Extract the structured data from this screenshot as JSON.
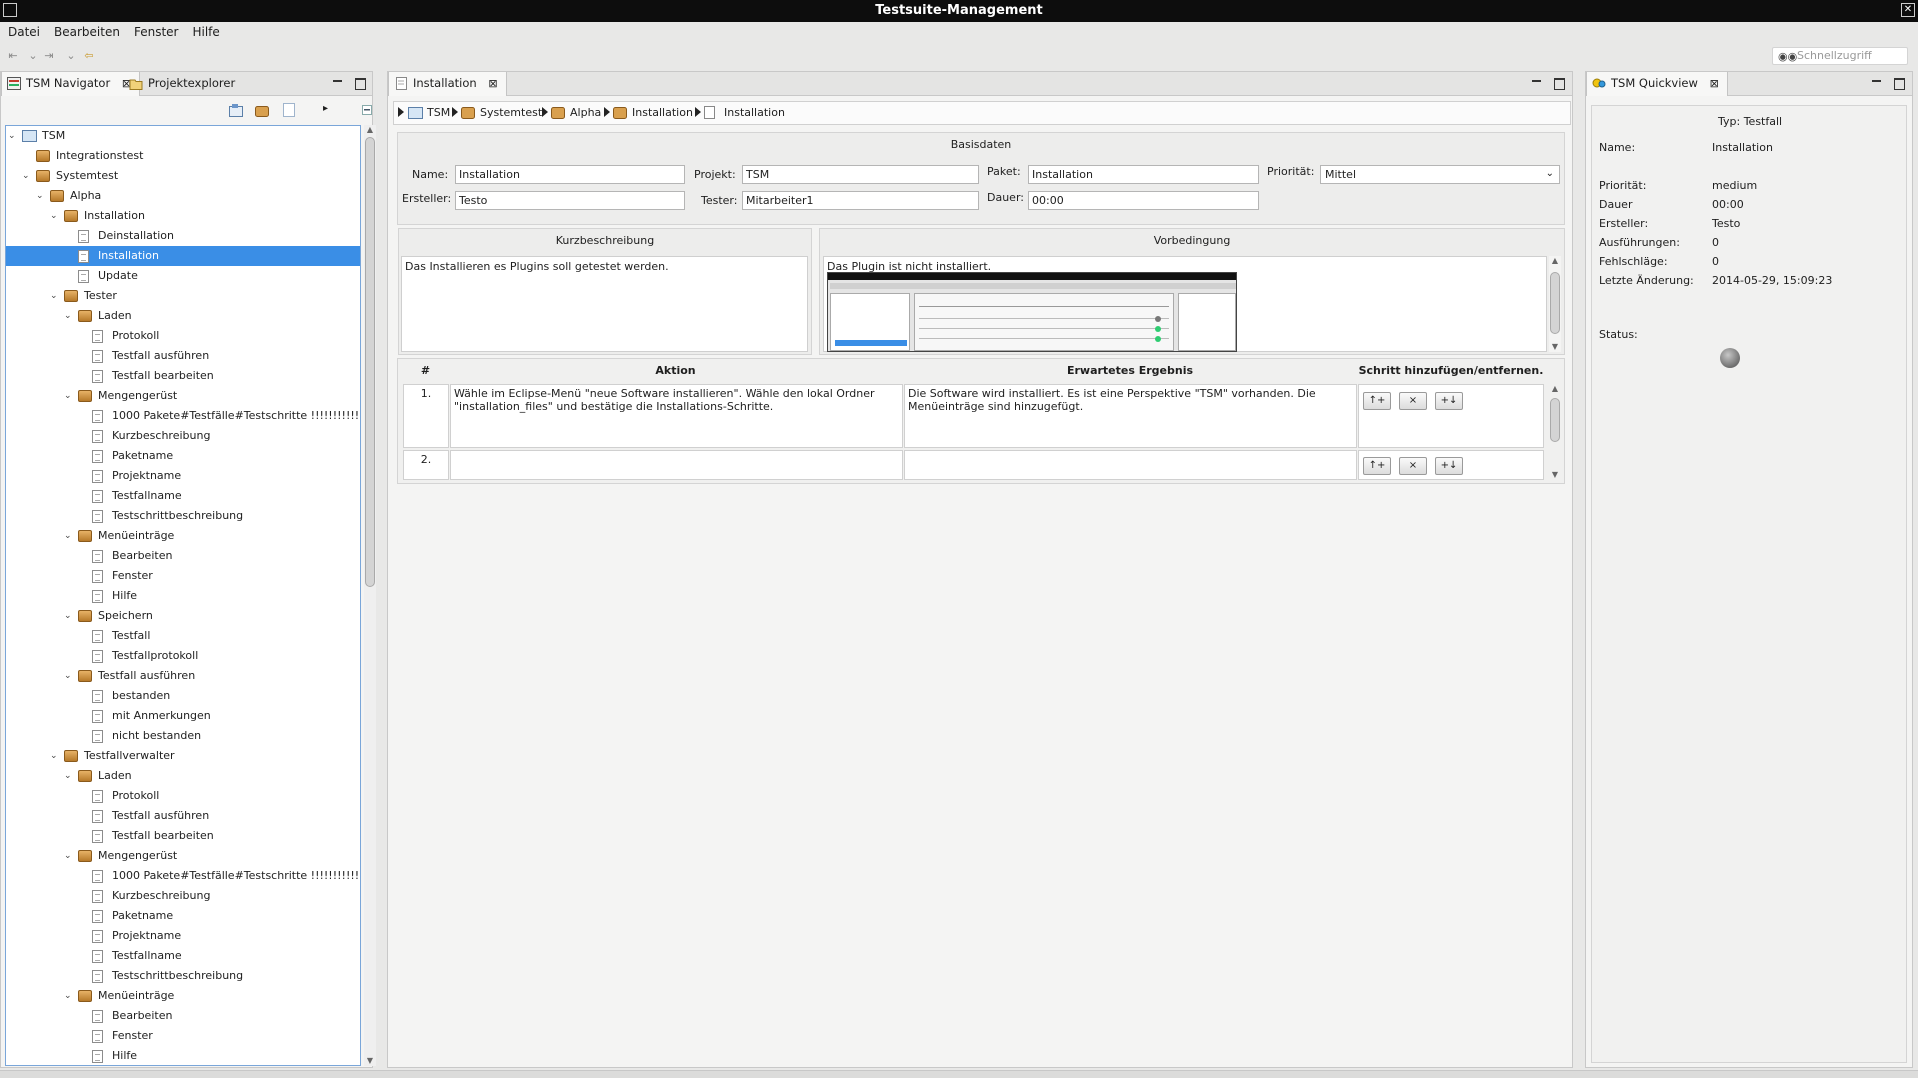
{
  "window": {
    "title": "Testsuite-Management"
  },
  "menu": {
    "items": [
      {
        "label": "Datei"
      },
      {
        "label": "Bearbeiten"
      },
      {
        "label": "Fenster"
      },
      {
        "label": "Hilfe"
      }
    ]
  },
  "toolbar": {
    "quick_access_placeholder": "Schnellzugriff"
  },
  "left_view": {
    "tabs": [
      {
        "label": "TSM Navigator",
        "active": true
      },
      {
        "label": "Projektexplorer",
        "active": false
      }
    ],
    "tree": [
      {
        "label": "TSM",
        "type": "root",
        "depth": 0,
        "expanded": true
      },
      {
        "label": "Integrationstest",
        "type": "pkg",
        "depth": 1
      },
      {
        "label": "Systemtest",
        "type": "pkg",
        "depth": 1,
        "expanded": true
      },
      {
        "label": "Alpha",
        "type": "pkg",
        "depth": 2,
        "expanded": true
      },
      {
        "label": "Installation",
        "type": "pkg",
        "depth": 3,
        "expanded": true
      },
      {
        "label": "Deinstallation",
        "type": "doc",
        "depth": 4
      },
      {
        "label": "Installation",
        "type": "doc",
        "depth": 4,
        "selected": true
      },
      {
        "label": "Update",
        "type": "doc",
        "depth": 4
      },
      {
        "label": "Tester",
        "type": "pkg",
        "depth": 3,
        "expanded": true
      },
      {
        "label": "Laden",
        "type": "pkg",
        "depth": 4,
        "expanded": true
      },
      {
        "label": "Protokoll",
        "type": "doc",
        "depth": 5
      },
      {
        "label": "Testfall ausführen",
        "type": "doc",
        "depth": 5
      },
      {
        "label": "Testfall bearbeiten",
        "type": "doc",
        "depth": 5
      },
      {
        "label": "Mengengerüst",
        "type": "pkg",
        "depth": 4,
        "expanded": true
      },
      {
        "label": "1000 Pakete#Testfälle#Testschritte !!!!!!!!!!!",
        "type": "doc",
        "depth": 5
      },
      {
        "label": "Kurzbeschreibung",
        "type": "doc",
        "depth": 5
      },
      {
        "label": "Paketname",
        "type": "doc",
        "depth": 5
      },
      {
        "label": "Projektname",
        "type": "doc",
        "depth": 5
      },
      {
        "label": "Testfallname",
        "type": "doc",
        "depth": 5
      },
      {
        "label": "Testschrittbeschreibung",
        "type": "doc",
        "depth": 5
      },
      {
        "label": "Menüeinträge",
        "type": "pkg",
        "depth": 4,
        "expanded": true
      },
      {
        "label": "Bearbeiten",
        "type": "doc",
        "depth": 5
      },
      {
        "label": "Fenster",
        "type": "doc",
        "depth": 5
      },
      {
        "label": "Hilfe",
        "type": "doc",
        "depth": 5
      },
      {
        "label": "Speichern",
        "type": "pkg",
        "depth": 4,
        "expanded": true
      },
      {
        "label": "Testfall",
        "type": "doc",
        "depth": 5
      },
      {
        "label": "Testfallprotokoll",
        "type": "doc",
        "depth": 5
      },
      {
        "label": "Testfall ausführen",
        "type": "pkg",
        "depth": 4,
        "expanded": true
      },
      {
        "label": "bestanden",
        "type": "doc",
        "depth": 5
      },
      {
        "label": "mit Anmerkungen",
        "type": "doc",
        "depth": 5
      },
      {
        "label": "nicht bestanden",
        "type": "doc",
        "depth": 5
      },
      {
        "label": "Testfallverwalter",
        "type": "pkg",
        "depth": 3,
        "expanded": true
      },
      {
        "label": "Laden",
        "type": "pkg",
        "depth": 4,
        "expanded": true
      },
      {
        "label": "Protokoll",
        "type": "doc",
        "depth": 5
      },
      {
        "label": "Testfall ausführen",
        "type": "doc",
        "depth": 5
      },
      {
        "label": "Testfall bearbeiten",
        "type": "doc",
        "depth": 5
      },
      {
        "label": "Mengengerüst",
        "type": "pkg",
        "depth": 4,
        "expanded": true
      },
      {
        "label": "1000 Pakete#Testfälle#Testschritte !!!!!!!!!!!",
        "type": "doc",
        "depth": 5
      },
      {
        "label": "Kurzbeschreibung",
        "type": "doc",
        "depth": 5
      },
      {
        "label": "Paketname",
        "type": "doc",
        "depth": 5
      },
      {
        "label": "Projektname",
        "type": "doc",
        "depth": 5
      },
      {
        "label": "Testfallname",
        "type": "doc",
        "depth": 5
      },
      {
        "label": "Testschrittbeschreibung",
        "type": "doc",
        "depth": 5
      },
      {
        "label": "Menüeinträge",
        "type": "pkg",
        "depth": 4,
        "expanded": true
      },
      {
        "label": "Bearbeiten",
        "type": "doc",
        "depth": 5
      },
      {
        "label": "Fenster",
        "type": "doc",
        "depth": 5
      },
      {
        "label": "Hilfe",
        "type": "doc",
        "depth": 5
      }
    ]
  },
  "editor": {
    "tab_label": "Installation",
    "breadcrumb": [
      "TSM",
      "Systemtest",
      "Alpha",
      "Installation",
      "Installation"
    ],
    "basisdaten": {
      "title": "Basisdaten",
      "name_label": "Name:",
      "name_value": "Installation",
      "projekt_label": "Projekt:",
      "projekt_value": "TSM",
      "paket_label": "Paket:",
      "paket_value": "Installation",
      "prioritaet_label": "Priorität:",
      "prioritaet_value": "Mittel",
      "ersteller_label": "Ersteller:",
      "ersteller_value": "Testo",
      "tester_label": "Tester:",
      "tester_value": "Mitarbeiter1",
      "dauer_label": "Dauer:",
      "dauer_value": "00:00"
    },
    "kurzbeschreibung": {
      "title": "Kurzbeschreibung",
      "text": "Das Installieren es Plugins soll getestet werden."
    },
    "vorbedingung": {
      "title": "Vorbedingung",
      "text": "Das Plugin ist nicht installiert."
    },
    "steps": {
      "headers": [
        "#",
        "Aktion",
        "Erwartetes Ergebnis",
        "Schritt hinzufügen/entfernen."
      ],
      "rows": [
        {
          "num": "1.",
          "aktion": "Wähle im Eclipse-Menü \"neue Software installieren\". Wähle den lokal Ordner \"installation_files\" und bestätige die Installations-Schritte.",
          "ergebnis": "Die Software wird installiert. Es ist eine Perspektive \"TSM\" vorhanden. Die Menüeinträge sind hinzugefügt."
        },
        {
          "num": "2.",
          "aktion": "",
          "ergebnis": ""
        }
      ],
      "buttons": {
        "up": "↑+",
        "remove": "×",
        "down": "+↓"
      }
    }
  },
  "quickview": {
    "tab_label": "TSM Quickview",
    "typ": "Typ: Testfall",
    "fields": [
      {
        "label": "Name:",
        "value": "Installation"
      },
      {
        "label": "Priorität:",
        "value": "medium"
      },
      {
        "label": "Dauer",
        "value": "00:00"
      },
      {
        "label": "Ersteller:",
        "value": "Testo"
      },
      {
        "label": "Ausführungen:",
        "value": "0"
      },
      {
        "label": "Fehlschläge:",
        "value": "0"
      },
      {
        "label": "Letzte Änderung:",
        "value": "2014-05-29, 15:09:23"
      }
    ],
    "status_label": "Status:"
  }
}
